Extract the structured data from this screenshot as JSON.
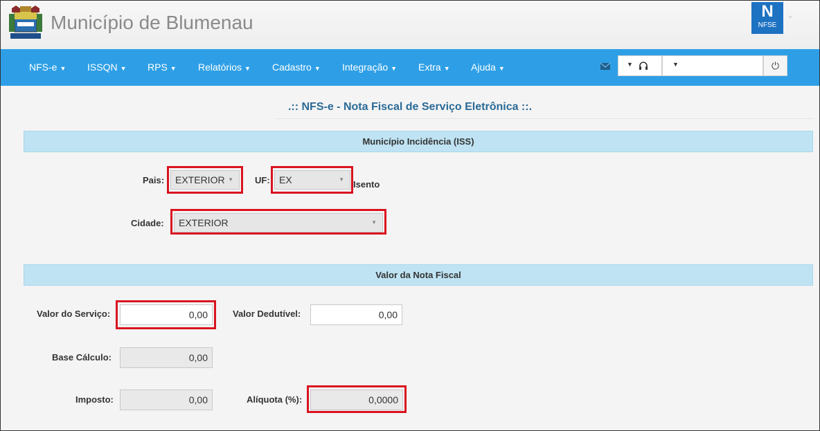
{
  "header": {
    "title": "Município de Blumenau",
    "badge_big": "N",
    "badge_small": "NFSE"
  },
  "nav": {
    "items": [
      "NFS-e",
      "ISSQN",
      "RPS",
      "Relatórios",
      "Cadastro",
      "Integração",
      "Extra",
      "Ajuda"
    ]
  },
  "page": {
    "title": ".:: NFS-e - Nota Fiscal de Serviço Eletrônica ::."
  },
  "section1": {
    "title": "Município Incidência (ISS)",
    "pais_label": "Pais:",
    "pais_value": "EXTERIOR",
    "uf_label": "UF:",
    "uf_value": "EX",
    "isento_label": "Isento",
    "cidade_label": "Cidade:",
    "cidade_value": "EXTERIOR"
  },
  "section2": {
    "title": "Valor da Nota Fiscal",
    "valor_servico_label": "Valor do Serviço:",
    "valor_servico_value": "0,00",
    "valor_dedutivel_label": "Valor Dedutível:",
    "valor_dedutivel_value": "0,00",
    "base_calculo_label": "Base Cálculo:",
    "base_calculo_value": "0,00",
    "imposto_label": "Imposto:",
    "imposto_value": "0,00",
    "aliquota_label": "Alíquota (%):",
    "aliquota_value": "0,0000"
  },
  "colors": {
    "navbar": "#2e9fe6",
    "section_bar": "#bfe3f3",
    "highlight": "#d9141f",
    "title": "#2a6a96"
  }
}
